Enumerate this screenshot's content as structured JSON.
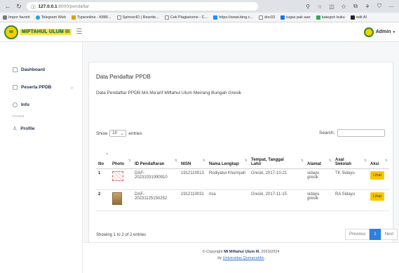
{
  "browser": {
    "url_host": "127.0.0.1",
    "url_path": ":8000/pendaftar",
    "bookmarks": [
      {
        "label": "Impor favorit",
        "color": "#7a7a7a"
      },
      {
        "label": "Telegram Web",
        "color": "#2a9fd8"
      },
      {
        "label": "Typeonline - KBBI...",
        "color": "#e0a100"
      },
      {
        "label": "SpinnerID | Rewrite...",
        "color": "#888888"
      },
      {
        "label": "Cek Plagiarisme - C...",
        "color": "#888888"
      },
      {
        "label": "https://www.bing.c...",
        "color": "#1f8fff"
      },
      {
        "label": "doc03",
        "color": "#888888"
      },
      {
        "label": "tugas pak aan",
        "color": "#1a73e8"
      },
      {
        "label": "kategori buku",
        "color": "#34a853"
      },
      {
        "label": "edit AI",
        "color": "#222222"
      }
    ]
  },
  "header": {
    "logo_text": "MI",
    "brand": "MIFTAHUL ULUM III",
    "user": "Admin"
  },
  "sidebar": {
    "items": [
      {
        "label": "Dashboard"
      },
      {
        "label": "Peserta PPDB"
      },
      {
        "label": "Info"
      }
    ],
    "heading": "PAGES",
    "profile": "Profile"
  },
  "card": {
    "title": "Data Pendaftar PPDB",
    "subtitle": "Data Pendaftar PPDB MA Ma'arif Miftahul Ulum Meirang Bungah Gresik",
    "show_label": "Show",
    "entries_value": "10",
    "entries_label": "entries",
    "search_label": "Search:",
    "columns": [
      "No",
      "Photo",
      "ID Pendaftaran",
      "NISN",
      "Nama Lengkap",
      "Tempat, Tanggal Lahir",
      "Alamat",
      "Asal Sekolah",
      "Aksi"
    ],
    "rows": [
      {
        "no": "1",
        "id": "DAF-20231031090910",
        "nisn": "1912110013",
        "nama": "Rodiyatul Khurriyah",
        "ttl": "Gresik, 2017-10-21",
        "alamat": "sidayu gresik",
        "asal": "TK Sidayu",
        "aksi": "Lihat"
      },
      {
        "no": "2",
        "id": "DAF-20231125150252",
        "nisn": "1912110031",
        "nama": "risa",
        "ttl": "Gresik, 2017-11-15",
        "alamat": "sidayu gresik",
        "asal": "RA Sidayu",
        "aksi": "Lihat"
      }
    ],
    "info": "Showing 1 to 2 of 2 entries",
    "pager": {
      "prev": "Previous",
      "current": "1",
      "next": "Next"
    }
  },
  "footer": {
    "copyright": "© Copyright",
    "brand": "MI Miftahul Ulum III.",
    "year": "2023/2024",
    "by": "by",
    "link": "Universitas Qomaruddin"
  }
}
